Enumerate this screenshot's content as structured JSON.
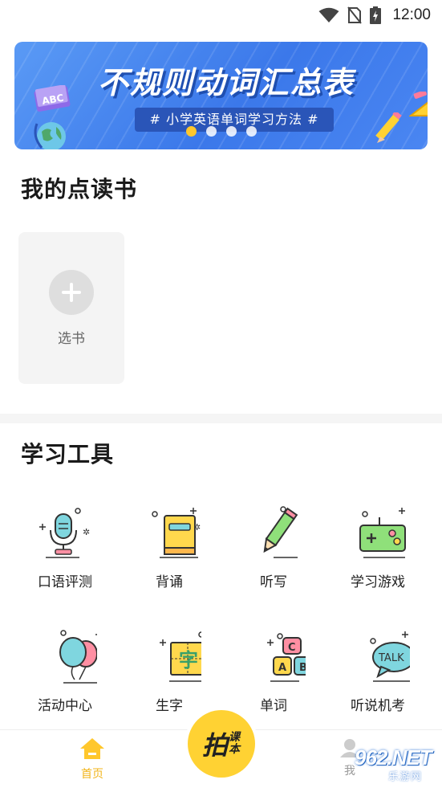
{
  "status_bar": {
    "time": "12:00"
  },
  "banner": {
    "title": "不规则动词汇总表",
    "subtitle": "# 小学英语单词学习方法 #",
    "abc_text": "ABC",
    "dot_count": 4,
    "active_dot": 0
  },
  "my_books": {
    "title": "我的点读书",
    "add_label": "选书"
  },
  "tools": {
    "title": "学习工具",
    "items": [
      {
        "label": "口语评测",
        "icon": "microphone-icon"
      },
      {
        "label": "背诵",
        "icon": "book-icon"
      },
      {
        "label": "听写",
        "icon": "pencil-icon"
      },
      {
        "label": "学习游戏",
        "icon": "gamepad-icon"
      },
      {
        "label": "活动中心",
        "icon": "balloons-icon"
      },
      {
        "label": "生字",
        "icon": "character-card-icon",
        "glyph": "字"
      },
      {
        "label": "单词",
        "icon": "letter-blocks-icon",
        "letters": [
          "C",
          "A",
          "B"
        ]
      },
      {
        "label": "听说机考",
        "icon": "talk-bubble-icon",
        "bubble": "TALK"
      }
    ]
  },
  "bottom_nav": {
    "home_label": "首页",
    "scan_big": "拍",
    "scan_small": "课本",
    "me_label": "我"
  },
  "watermark": {
    "text": "962.NET",
    "sub": "乐游网"
  },
  "colors": {
    "accent": "#ffc72c",
    "banner_blue": "#3b78ea",
    "tool_teal": "#7fd6df",
    "tool_yellow": "#ffd84d"
  }
}
